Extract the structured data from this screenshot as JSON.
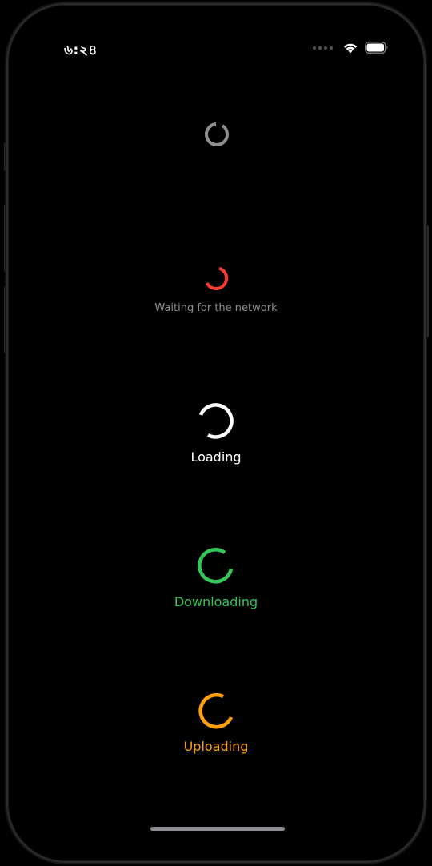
{
  "status_bar": {
    "time": "৬:২৪"
  },
  "spinners": [
    {
      "label": "",
      "color": "#8e8e93",
      "size": "small"
    },
    {
      "label": "Waiting for the network",
      "color": "#ff3b30",
      "label_color": "#8e8e93",
      "size": "small"
    },
    {
      "label": "Loading",
      "color": "#ffffff",
      "label_color": "#ffffff",
      "size": "large"
    },
    {
      "label": "Downloading",
      "color": "#34c759",
      "label_color": "#34c759",
      "size": "large"
    },
    {
      "label": "Uploading",
      "color": "#ff9f0a",
      "label_color": "#ff9f0a",
      "size": "large"
    }
  ],
  "icons": {
    "wifi": "wifi-icon",
    "battery": "battery-icon",
    "signal": "cellular-signal-icon"
  }
}
